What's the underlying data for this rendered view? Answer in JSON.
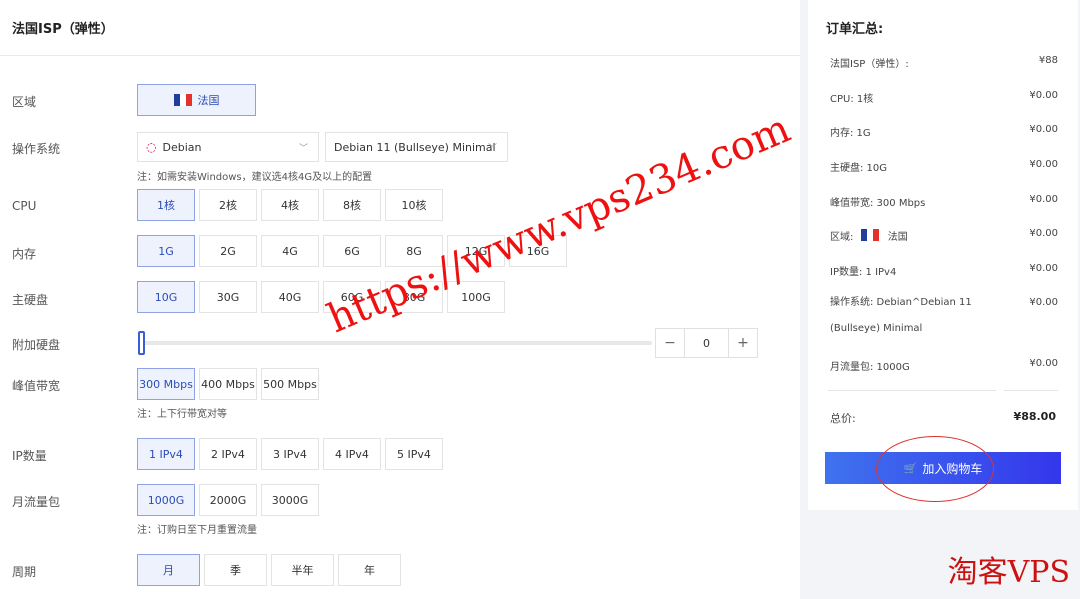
{
  "page": {
    "title": "法国ISP（弹性）"
  },
  "config": {
    "region": {
      "label": "区域",
      "value": "法国"
    },
    "os": {
      "label": "操作系统",
      "distro": "Debian",
      "version": "Debian 11 (Bullseye) Minimal",
      "note": "注：如需安装Windows，建议选4核4G及以上的配置"
    },
    "cpu": {
      "label": "CPU",
      "options": [
        "1核",
        "2核",
        "4核",
        "8核",
        "10核"
      ],
      "selected": 0
    },
    "memory": {
      "label": "内存",
      "options": [
        "1G",
        "2G",
        "4G",
        "6G",
        "8G",
        "12G",
        "16G"
      ],
      "selected": 0
    },
    "disk": {
      "label": "主硬盘",
      "options": [
        "10G",
        "30G",
        "40G",
        "60G",
        "80G",
        "100G"
      ],
      "selected": 0
    },
    "extra_disk": {
      "label": "附加硬盘",
      "value": "0",
      "minus": "−",
      "plus": "+"
    },
    "bandwidth": {
      "label": "峰值带宽",
      "options": [
        "300 Mbps",
        "400 Mbps",
        "500 Mbps"
      ],
      "selected": 0,
      "note": "注：上下行带宽对等"
    },
    "ip": {
      "label": "IP数量",
      "options": [
        "1 IPv4",
        "2 IPv4",
        "3 IPv4",
        "4 IPv4",
        "5 IPv4"
      ],
      "selected": 0
    },
    "traffic": {
      "label": "月流量包",
      "options": [
        "1000G",
        "2000G",
        "3000G"
      ],
      "selected": 0,
      "note": "注：订购日至下月重置流量"
    },
    "period": {
      "label": "周期",
      "options": [
        "月",
        "季",
        "半年",
        "年"
      ],
      "selected": 0
    }
  },
  "summary": {
    "title": "订单汇总:",
    "rows": [
      {
        "label": "法国ISP（弹性）:",
        "price": "¥88"
      },
      {
        "label": "CPU: 1核",
        "price": "¥0.00"
      },
      {
        "label": "内存: 1G",
        "price": "¥0.00"
      },
      {
        "label": "主硬盘: 10G",
        "price": "¥0.00"
      },
      {
        "label": "峰值带宽: 300 Mbps",
        "price": "¥0.00"
      },
      {
        "label": "区域:",
        "region": "法国",
        "price": "¥0.00"
      },
      {
        "label": "IP数量: 1 IPv4",
        "price": "¥0.00"
      },
      {
        "label": "操作系统: Debian^Debian 11 (Bullseye) Minimal",
        "price": "¥0.00"
      },
      {
        "label": "月流量包: 1000G",
        "price": "¥0.00"
      }
    ],
    "total_label": "总价:",
    "total_price": "¥88.00",
    "cart_button": "加入购物车"
  },
  "watermark": "https://www.vps234.com",
  "brand": "淘客VPS",
  "colors": {
    "accent": "#3d5cd8",
    "selected_bg": "#eef2fc",
    "flag_blue": "#1f3f9a",
    "flag_red": "#e3322d",
    "mark_red": "#e11111"
  }
}
